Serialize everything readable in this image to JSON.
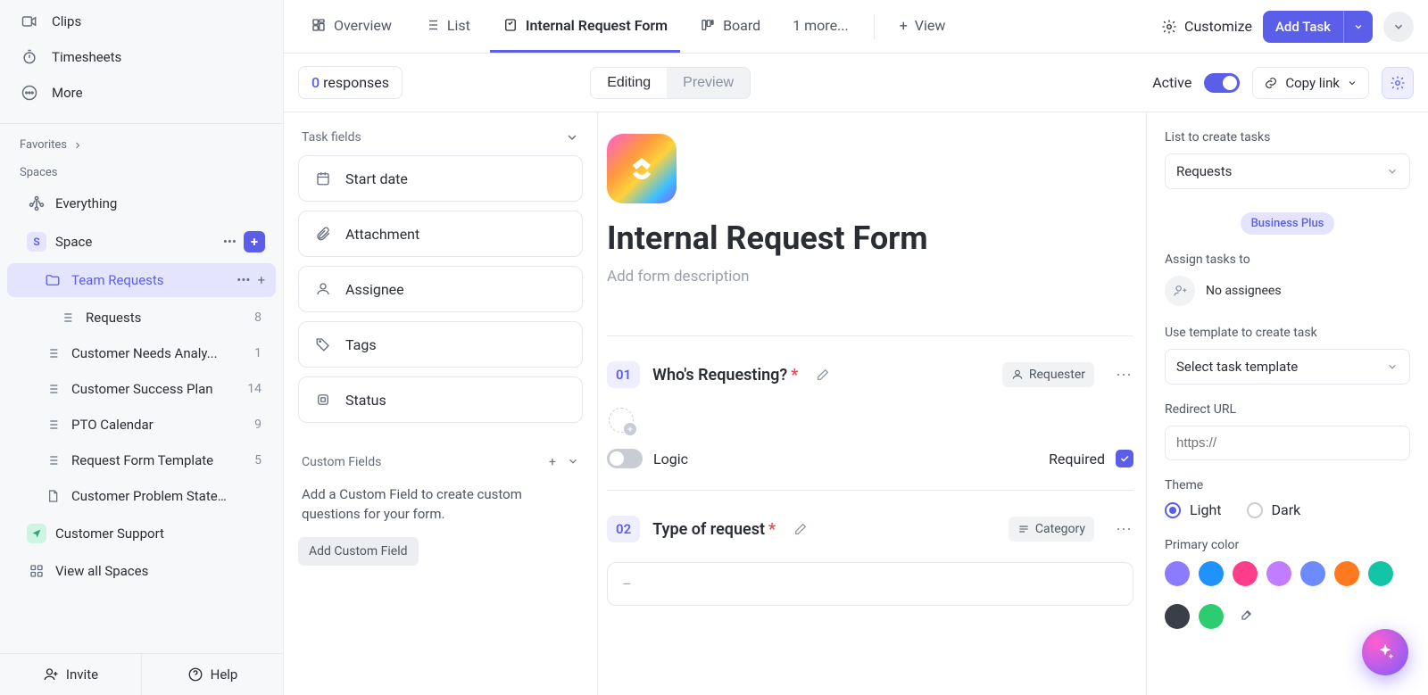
{
  "sidebar": {
    "nav": [
      {
        "name": "clips",
        "label": "Clips"
      },
      {
        "name": "timesheets",
        "label": "Timesheets"
      },
      {
        "name": "more",
        "label": "More"
      }
    ],
    "favorites_label": "Favorites",
    "spaces_label": "Spaces",
    "everything_label": "Everything",
    "space": {
      "letter": "S",
      "label": "Space"
    },
    "team_requests_label": "Team Requests",
    "lists": [
      {
        "label": "Requests",
        "count": "8",
        "indent": 2,
        "icon": "list"
      },
      {
        "label": "Customer Needs Analy...",
        "count": "1",
        "indent": 1,
        "icon": "list"
      },
      {
        "label": "Customer Success Plan",
        "count": "14",
        "indent": 1,
        "icon": "list"
      },
      {
        "label": "PTO Calendar",
        "count": "9",
        "indent": 1,
        "icon": "list"
      },
      {
        "label": "Request Form Template",
        "count": "5",
        "indent": 1,
        "icon": "list"
      },
      {
        "label": "Customer Problem Statem...",
        "count": "",
        "indent": 1,
        "icon": "doc"
      }
    ],
    "customer_support_label": "Customer Support",
    "view_all_label": "View all Spaces",
    "invite_label": "Invite",
    "help_label": "Help"
  },
  "tabs": {
    "overview": "Overview",
    "list": "List",
    "form": "Internal Request Form",
    "board": "Board",
    "more": "1 more...",
    "view": "View",
    "customize": "Customize",
    "add_task": "Add Task"
  },
  "subbar": {
    "responses_count": "0",
    "responses_label": "responses",
    "editing": "Editing",
    "preview": "Preview",
    "active": "Active",
    "copy_link": "Copy link"
  },
  "fields": {
    "header": "Task fields",
    "items": [
      {
        "label": "Start date",
        "icon": "calendar"
      },
      {
        "label": "Attachment",
        "icon": "clip"
      },
      {
        "label": "Assignee",
        "icon": "person"
      },
      {
        "label": "Tags",
        "icon": "tag"
      },
      {
        "label": "Status",
        "icon": "status"
      }
    ],
    "custom_header": "Custom Fields",
    "custom_text": "Add a Custom Field to create custom questions for your form.",
    "add_custom": "Add Custom Field"
  },
  "form": {
    "title": "Internal Request Form",
    "desc_placeholder": "Add form description",
    "questions": [
      {
        "num": "01",
        "title": "Who's Requesting?",
        "badge": "Requester",
        "logic": "Logic",
        "required": "Required"
      },
      {
        "num": "02",
        "title": "Type of request",
        "badge": "Category",
        "placeholder": "–"
      }
    ]
  },
  "settings": {
    "list_label": "List to create tasks",
    "list_value": "Requests",
    "plan_pill": "Business Plus",
    "assign_label": "Assign tasks to",
    "no_assignees": "No assignees",
    "template_label": "Use template to create task",
    "template_value": "Select task template",
    "redirect_label": "Redirect URL",
    "redirect_placeholder": "https://",
    "theme_label": "Theme",
    "theme_light": "Light",
    "theme_dark": "Dark",
    "primary_label": "Primary color",
    "colors": [
      "#8b7cff",
      "#1f92ff",
      "#ff3d8b",
      "#c17cff",
      "#6b8bff",
      "#ff7a1f",
      "#14c4a6",
      "#3a3f47",
      "#2ecc71"
    ]
  }
}
